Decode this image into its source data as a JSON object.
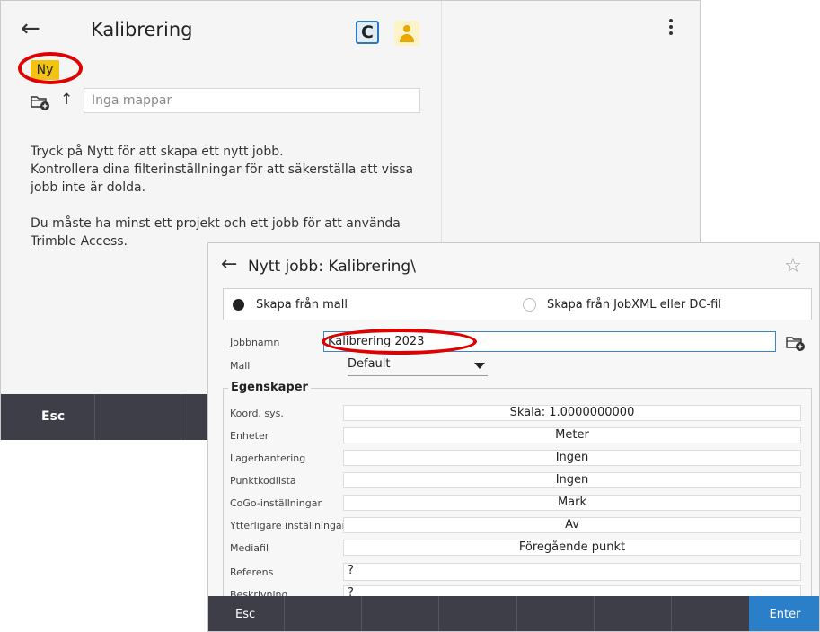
{
  "back_screen": {
    "title": "Kalibrering",
    "new_badge": "Ny",
    "folder_placeholder": "Inga mappar",
    "message_line1": "Tryck på Nytt för att skapa ett nytt jobb.",
    "message_line2": "Kontrollera dina filterinställningar för att säkerställa att vissa jobb inte är dolda.",
    "message_line3": "Du måste ha minst ett projekt och ett jobb för att använda Trimble Access.",
    "refresh_glyph": "C",
    "icons": [
      "back-arrow-icon",
      "refresh-icon",
      "user-icon",
      "kebab-menu-icon",
      "new-folder-icon",
      "up-arrow-icon"
    ],
    "esc_label": "Esc"
  },
  "dialog": {
    "title": "Nytt jobb: Kalibrering\\",
    "radio_from_template": "Skapa från mall",
    "radio_from_file": "Skapa från JobXML eller DC-fil",
    "selected_radio": "Skapa från mall",
    "job_name_label": "Jobbnamn",
    "job_name_value": "Kalibrering 2023",
    "template_label": "Mall",
    "template_value": "Default",
    "properties_title": "Egenskaper",
    "properties": [
      {
        "label": "Koord. sys.",
        "value": "Skala: 1.0000000000"
      },
      {
        "label": "Enheter",
        "value": "Meter"
      },
      {
        "label": "Lagerhantering",
        "value": "Ingen"
      },
      {
        "label": "Punktkodlista",
        "value": "Ingen"
      },
      {
        "label": "CoGo-inställningar",
        "value": "Mark"
      },
      {
        "label": "Ytterligare inställningar",
        "value": "Av"
      },
      {
        "label": "Mediafil",
        "value": "Föregående punkt"
      },
      {
        "label": "Referens",
        "value": "?"
      },
      {
        "label": "Beskrivning",
        "value": "?"
      }
    ],
    "esc_label": "Esc",
    "enter_label": "Enter"
  },
  "colors": {
    "highlight_ring": "#e00000",
    "badge_yellow": "#f3c213",
    "bottom_bar": "#3e3e48",
    "enter_blue": "#2a7fc8"
  }
}
